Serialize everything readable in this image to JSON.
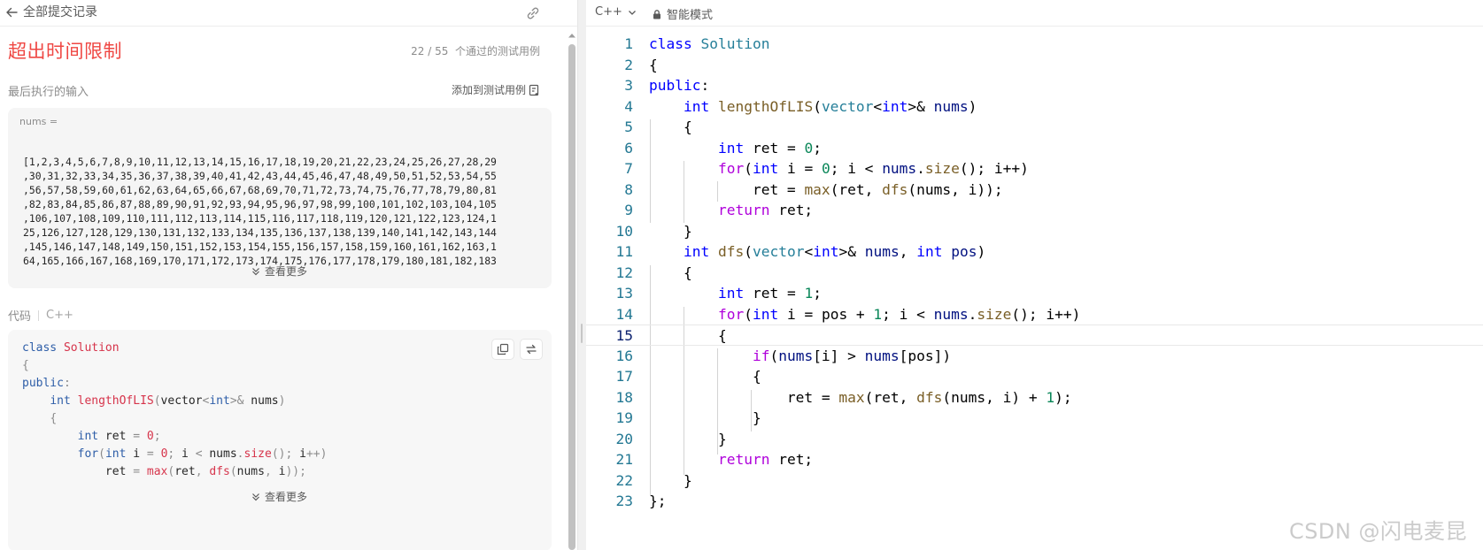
{
  "left_panel": {
    "header_title": "全部提交记录",
    "status": "超出时间限制",
    "passed_count": "22 / 55",
    "passed_label": "个通过的测试用例",
    "last_input_label": "最后执行的输入",
    "add_case_label": "添加到测试用例",
    "input_var": "nums =",
    "input_lines": [
      "[1,2,3,4,5,6,7,8,9,10,11,12,13,14,15,16,17,18,19,20,21,22,23,24,25,26,27,28,29",
      ",30,31,32,33,34,35,36,37,38,39,40,41,42,43,44,45,46,47,48,49,50,51,52,53,54,55",
      ",56,57,58,59,60,61,62,63,64,65,66,67,68,69,70,71,72,73,74,75,76,77,78,79,80,81",
      ",82,83,84,85,86,87,88,89,90,91,92,93,94,95,96,97,98,99,100,101,102,103,104,105",
      ",106,107,108,109,110,111,112,113,114,115,116,117,118,119,120,121,122,123,124,1",
      "25,126,127,128,129,130,131,132,133,134,135,136,137,138,139,140,141,142,143,144",
      ",145,146,147,148,149,150,151,152,153,154,155,156,157,158,159,160,161,162,163,1",
      "64,165,166,167,168,169,170,171,172,173,174,175,176,177,178,179,180,181,182,183"
    ],
    "show_more": "查看更多",
    "code_label": "代码",
    "code_lang": "C++",
    "code_show_more": "查看更多"
  },
  "editor": {
    "language": "C++",
    "mode": "智能模式",
    "current_line": 15
  },
  "watermark": "CSDN @闪电麦昆",
  "colors": {
    "status_red": "#ef4743",
    "keyword": "#0000ff",
    "type": "#267f99",
    "control": "#af00db",
    "function": "#795e26",
    "number": "#098658",
    "line_number": "#237893"
  },
  "icons": [
    "back-arrow-icon",
    "link-icon",
    "add-case-icon",
    "chevron-double-down-icon",
    "copy-icon",
    "swap-icon",
    "chevron-down-icon",
    "lock-icon"
  ]
}
